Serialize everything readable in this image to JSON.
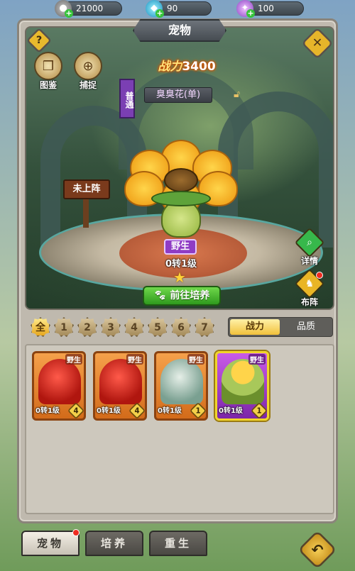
{
  "resources": {
    "gold": "21000",
    "gems": "90",
    "crystals": "100"
  },
  "header": {
    "title": "宠物",
    "help_label": "?",
    "close_label": "✕"
  },
  "left_buttons": {
    "codex": "图鉴",
    "capture": "捕捉"
  },
  "pet": {
    "power_label": "战力",
    "power_value": "3400",
    "rarity": "普通",
    "name": "臭臭花(单)",
    "status": "未上阵",
    "type_badge": "野生",
    "level": "0转1级",
    "train_button": "前往培养"
  },
  "right_buttons": {
    "details": "详情",
    "formation": "布阵"
  },
  "filters": [
    "全",
    "1",
    "2",
    "3",
    "4",
    "5",
    "6",
    "7"
  ],
  "sort": {
    "options": [
      "战力",
      "品质"
    ],
    "selected": "战力"
  },
  "pet_cards": [
    {
      "wild": "野生",
      "level": "0转1级",
      "count": "4",
      "style": "red"
    },
    {
      "wild": "野生",
      "level": "0转1级",
      "count": "4",
      "style": "red"
    },
    {
      "wild": "野生",
      "level": "0转1级",
      "count": "1",
      "style": "gray"
    },
    {
      "wild": "野生",
      "level": "0转1级",
      "count": "1",
      "style": "flower"
    }
  ],
  "bottom_tabs": [
    {
      "label": "宠物",
      "active": true
    },
    {
      "label": "培养",
      "active": false
    },
    {
      "label": "重生",
      "active": false
    }
  ],
  "colors": {
    "accent_gold": "#f1c13b",
    "rarity_purple": "#7b3fb3",
    "train_green": "#2f9a1d",
    "notify_red": "#ee2b20"
  }
}
